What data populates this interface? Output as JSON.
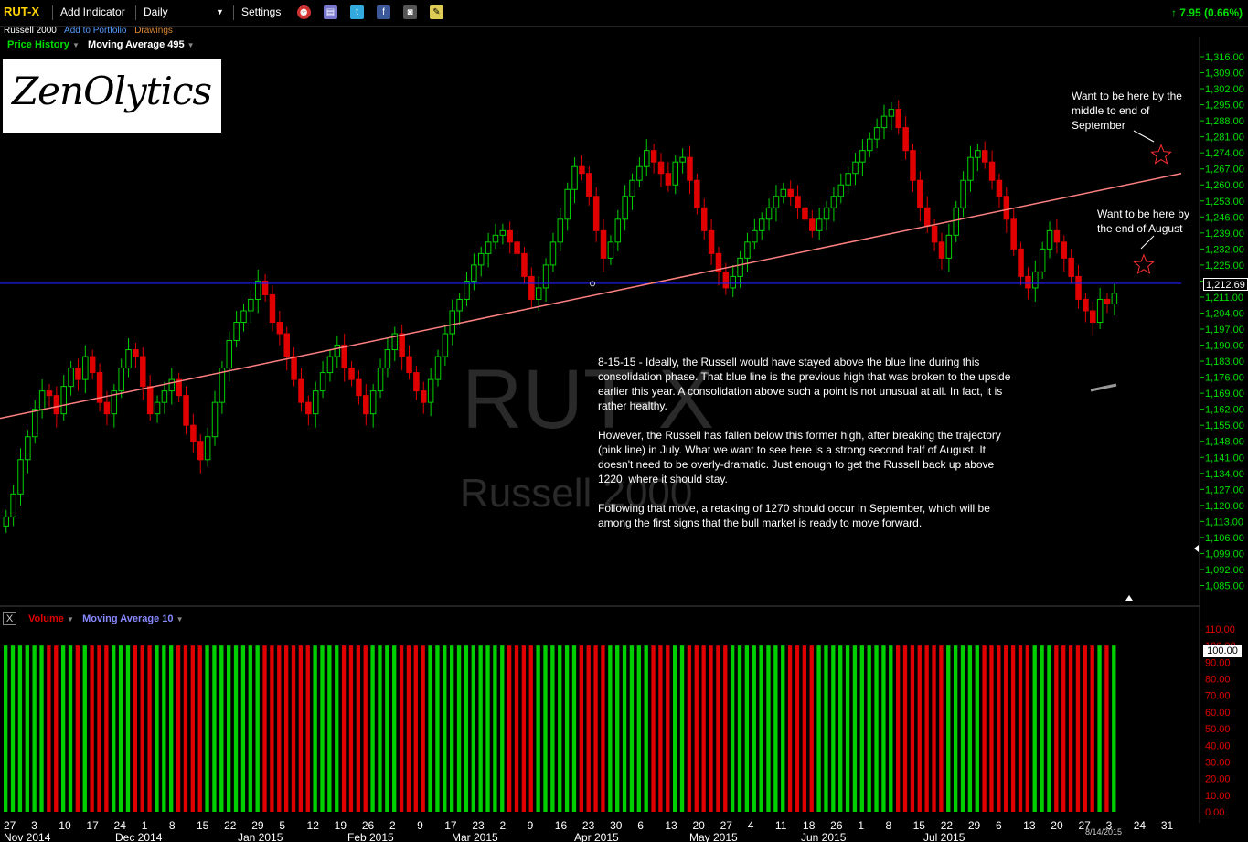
{
  "toolbar": {
    "symbol": "RUT-X",
    "add_indicator": "Add Indicator",
    "interval": "Daily",
    "settings": "Settings",
    "change": "7.95 (0.66%)"
  },
  "subheader": {
    "name": "Russell 2000",
    "add_to_portfolio": "Add to Portfolio",
    "drawings": "Drawings"
  },
  "upper_indicators": {
    "price_history": "Price History",
    "moving_average": "Moving Average 495"
  },
  "lower_indicators": {
    "close": "X",
    "volume": "Volume",
    "moving_average": "Moving Average 10"
  },
  "logo": {
    "text": "ZenOlytics"
  },
  "watermark": {
    "symbol": "RUT-X",
    "name": "Russell 2000"
  },
  "annotations": {
    "september": "Want to be here by the middle to end of September",
    "august": "Want to be here by the end of August",
    "commentary": [
      "8-15-15 - Ideally, the Russell would have stayed above the blue line during this consolidation phase. That blue line is the previous high that was broken to the upside earlier this year. A consolidation above such a point is not unusual at all. In fact, it is rather healthy.",
      "However, the Russell has fallen below this former high, after breaking the trajectory (pink line) in July. What we want to see here is a strong second half of August. It doesn't need to be overly-dramatic. Just enough to get the Russell back up above 1220, where it should stay.",
      "Following that move, a retaking of 1270 should occur in September, which will be among the first signs that the bull market is ready to move forward."
    ]
  },
  "last_price": "1,212.69",
  "volume_last": "100.00",
  "footer_date": "8/14/2015",
  "colors": {
    "up": "#00d000",
    "down": "#e00000",
    "support": "#2020ff",
    "trend": "#ff8080",
    "axis": "#00e000",
    "vol_axis": "#e00000"
  },
  "chart_data": {
    "type": "candlestick",
    "title": "RUT-X",
    "ylim": [
      1082,
      1318
    ],
    "y_ticks": [
      "1,085.00",
      "1,092.00",
      "1,099.00",
      "1,106.00",
      "1,113.00",
      "1,120.00",
      "1,127.00",
      "1,134.00",
      "1,141.00",
      "1,148.00",
      "1,155.00",
      "1,162.00",
      "1,169.00",
      "1,176.00",
      "1,183.00",
      "1,190.00",
      "1,197.00",
      "1,204.00",
      "1,211.00",
      "1,218.00",
      "1,225.00",
      "1,232.00",
      "1,239.00",
      "1,246.00",
      "1,253.00",
      "1,260.00",
      "1,267.00",
      "1,274.00",
      "1,281.00",
      "1,288.00",
      "1,295.00",
      "1,302.00",
      "1,309.00",
      "1,316.00"
    ],
    "x_day_labels": [
      "27",
      "3",
      "10",
      "17",
      "24",
      "1",
      "8",
      "15",
      "22",
      "29",
      "5",
      "12",
      "19",
      "26",
      "2",
      "9",
      "17",
      "23",
      "2",
      "9",
      "16",
      "23",
      "30",
      "6",
      "13",
      "20",
      "27",
      "4",
      "11",
      "18",
      "26",
      "1",
      "8",
      "15",
      "22",
      "29",
      "6",
      "13",
      "20",
      "27",
      "3",
      "24",
      "31"
    ],
    "x_month_labels": [
      "Nov 2014",
      "Dec 2014",
      "Jan 2015",
      "Feb 2015",
      "Mar 2015",
      "Apr 2015",
      "May 2015",
      "Jun 2015",
      "Jul 2015"
    ],
    "support_level": 1217,
    "trend_line": {
      "start": 1158,
      "end": 1265
    },
    "targets": [
      {
        "label": "end of August",
        "value": 1225
      },
      {
        "label": "September",
        "value": 1273
      }
    ],
    "closes": [
      1115,
      1125,
      1140,
      1150,
      1162,
      1170,
      1168,
      1160,
      1172,
      1180,
      1175,
      1185,
      1178,
      1165,
      1160,
      1170,
      1180,
      1188,
      1185,
      1172,
      1160,
      1165,
      1170,
      1175,
      1168,
      1155,
      1148,
      1140,
      1150,
      1165,
      1180,
      1192,
      1200,
      1205,
      1210,
      1218,
      1212,
      1200,
      1195,
      1185,
      1175,
      1165,
      1160,
      1170,
      1178,
      1185,
      1190,
      1180,
      1175,
      1168,
      1160,
      1170,
      1180,
      1188,
      1195,
      1185,
      1178,
      1170,
      1165,
      1175,
      1185,
      1195,
      1205,
      1210,
      1218,
      1225,
      1230,
      1235,
      1238,
      1240,
      1235,
      1230,
      1220,
      1210,
      1215,
      1225,
      1235,
      1245,
      1258,
      1268,
      1265,
      1255,
      1240,
      1228,
      1235,
      1245,
      1255,
      1262,
      1268,
      1275,
      1270,
      1265,
      1260,
      1270,
      1272,
      1262,
      1250,
      1240,
      1230,
      1222,
      1215,
      1220,
      1228,
      1235,
      1240,
      1245,
      1250,
      1255,
      1258,
      1255,
      1250,
      1245,
      1240,
      1245,
      1250,
      1255,
      1260,
      1265,
      1270,
      1275,
      1280,
      1285,
      1290,
      1293,
      1285,
      1275,
      1262,
      1250,
      1242,
      1235,
      1228,
      1238,
      1250,
      1262,
      1272,
      1275,
      1270,
      1262,
      1255,
      1245,
      1232,
      1220,
      1215,
      1222,
      1232,
      1240,
      1235,
      1228,
      1220,
      1210,
      1205,
      1200,
      1210,
      1208,
      1212.69
    ],
    "volume": {
      "ylim": [
        0,
        110
      ],
      "y_ticks": [
        "0.00",
        "10.00",
        "20.00",
        "30.00",
        "40.00",
        "50.00",
        "60.00",
        "70.00",
        "80.00",
        "90.00",
        "100.00",
        "110.00"
      ],
      "bar_value": 100
    }
  }
}
